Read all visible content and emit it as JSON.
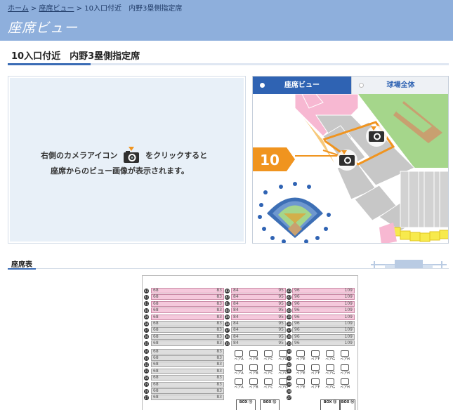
{
  "breadcrumb": {
    "home": "ホーム",
    "seatview": "座席ビュー",
    "current": "10入口付近　内野3塁側指定席",
    "sep": ">"
  },
  "header": {
    "title": "座席ビュー"
  },
  "section": {
    "title": "10入口付近　内野3塁側指定席"
  },
  "info": {
    "line1_before": "右側のカメラアイコン",
    "line1_after": "をクリックすると",
    "line2": "座席からのビュー画像が表示されます。"
  },
  "tabs": [
    {
      "label": "座席ビュー",
      "active": true
    },
    {
      "label": "球場全体",
      "active": false
    }
  ],
  "map": {
    "gate_label": "10",
    "accent_color": "#f0941f",
    "pink": "#f7b8d2",
    "field_green": "#a5d68b"
  },
  "seat_table": {
    "title": "座席表",
    "rows": [
      {
        "num": "43",
        "a": [
          "68",
          "83"
        ],
        "b": [
          "84",
          "95"
        ],
        "c": [
          "96",
          "109"
        ],
        "color": "pink"
      },
      {
        "num": "42",
        "a": [
          "68",
          "83"
        ],
        "b": [
          "84",
          "95"
        ],
        "c": [
          "96",
          "109"
        ],
        "color": "pink"
      },
      {
        "num": "41",
        "a": [
          "68",
          "83"
        ],
        "b": [
          "84",
          "95"
        ],
        "c": [
          "96",
          "109"
        ],
        "color": "pink"
      },
      {
        "num": "40",
        "a": [
          "68",
          "83"
        ],
        "b": [
          "84",
          "95"
        ],
        "c": [
          "96",
          "109"
        ],
        "color": "pink"
      },
      {
        "num": "39",
        "a": [
          "68",
          "83"
        ],
        "b": [
          "84",
          "95"
        ],
        "c": [
          "96",
          "109"
        ],
        "color": "pink"
      },
      {
        "num": "38",
        "a": [
          "68",
          "83"
        ],
        "b": [
          "84",
          "95"
        ],
        "c": [
          "96",
          "109"
        ],
        "color": "gray"
      },
      {
        "num": "37",
        "a": [
          "68",
          "83"
        ],
        "b": [
          "84",
          "95"
        ],
        "c": [
          "96",
          "109"
        ],
        "color": "gray"
      },
      {
        "num": "36",
        "a": [
          "68",
          "83"
        ],
        "b": [
          "84",
          "95"
        ],
        "c": [
          "96",
          "109"
        ],
        "color": "gray"
      },
      {
        "num": "35",
        "a": [
          "68",
          "83"
        ],
        "b": [
          "84",
          "95"
        ],
        "c": [
          "96",
          "109"
        ],
        "color": "gray"
      }
    ],
    "lower_rows": [
      {
        "num": "34",
        "a": [
          "68",
          "83"
        ]
      },
      {
        "num": "33",
        "a": [
          "68",
          "83"
        ]
      },
      {
        "num": "32",
        "a": [
          "68",
          "83"
        ]
      },
      {
        "num": "31",
        "a": [
          "68",
          "83"
        ]
      },
      {
        "num": "30",
        "a": [
          "68",
          "83"
        ]
      },
      {
        "num": "29",
        "a": [
          "68",
          "83"
        ]
      },
      {
        "num": "28",
        "a": [
          "68",
          "83"
        ]
      },
      {
        "num": "27",
        "a": [
          "68",
          "83"
        ]
      }
    ],
    "pair_labels_b": [
      "ペアA",
      "ペアB",
      "ペアC",
      "ペアD"
    ],
    "pair_labels_c": [
      "ペアE",
      "ペアF",
      "ペアG",
      "ペアH"
    ],
    "boxes": [
      "BOX\n⑪",
      "BOX\n⑫",
      "BOX\n⑬",
      "BOX\n⑭"
    ]
  }
}
